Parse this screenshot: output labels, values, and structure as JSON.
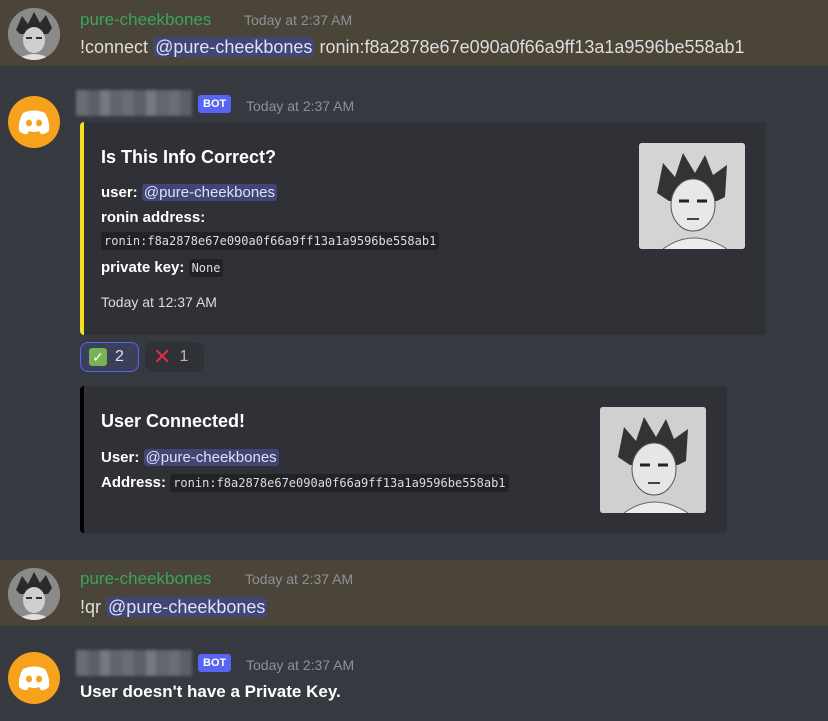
{
  "messages": {
    "m1": {
      "username": "pure-cheekbones",
      "timestamp": "Today at 2:37 AM",
      "command": "!connect",
      "mention": "@pure-cheekbones",
      "arg": "ronin:f8a2878e67e090a0f66a9ff13a1a9596be558ab1"
    },
    "m2": {
      "badge": "BOT",
      "timestamp": "Today at 2:37 AM",
      "embed1": {
        "title": "Is This Info Correct?",
        "user_label": "user:",
        "user_mention": "@pure-cheekbones",
        "ronin_label": "ronin address:",
        "ronin_value": "ronin:f8a2878e67e090a0f66a9ff13a1a9596be558ab1",
        "pk_label": "private key:",
        "pk_value": "None",
        "footer": "Today at 12:37 AM",
        "bar_color": "#f5e11b"
      },
      "reactions": [
        {
          "icon": "check-mark-icon",
          "count": "2"
        },
        {
          "icon": "cross-mark-icon",
          "count": "1"
        }
      ],
      "embed2": {
        "title": "User Connected!",
        "user_label": "User:",
        "user_mention": "@pure-cheekbones",
        "addr_label": "Address:",
        "addr_value": "ronin:f8a2878e67e090a0f66a9ff13a1a9596be558ab1",
        "bar_color": "#000000"
      }
    },
    "m3": {
      "username": "pure-cheekbones",
      "timestamp": "Today at 2:37 AM",
      "command": "!qr",
      "mention": "@pure-cheekbones"
    },
    "m4": {
      "badge": "BOT",
      "timestamp": "Today at 2:37 AM",
      "text": "User doesn't have a Private Key."
    }
  }
}
